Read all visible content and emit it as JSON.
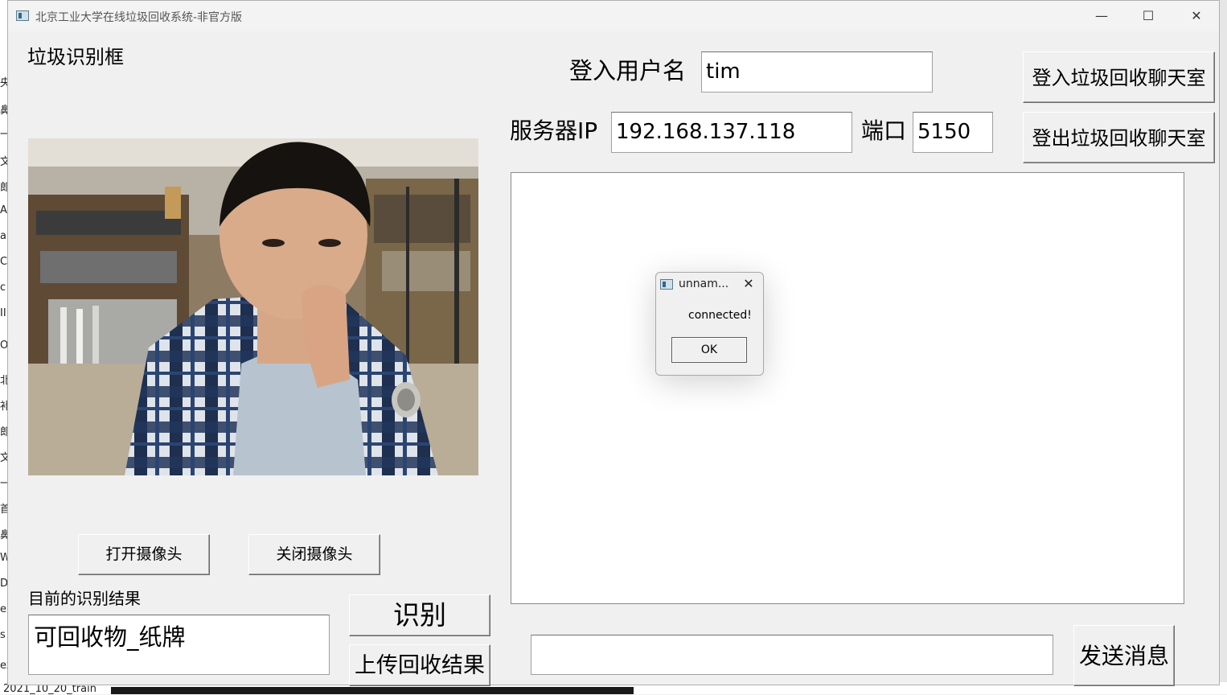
{
  "window": {
    "title": "北京工业大学在线垃圾回收系统-非官方版",
    "minimize_glyph": "—",
    "maximize_glyph": "☐",
    "close_glyph": "✕"
  },
  "left": {
    "frame_label": "垃圾识别框",
    "open_camera": "打开摄像头",
    "close_camera": "关闭摄像头",
    "result_label": "目前的识别结果",
    "result_value": "可回收物_纸牌",
    "recognize": "识别",
    "upload": "上传回收结果"
  },
  "right": {
    "username_label": "登入用户名",
    "username_value": "tim",
    "login_chat": "登入垃圾回收聊天室",
    "server_ip_label": "服务器IP",
    "server_ip_value": "192.168.137.118",
    "port_label": "端口",
    "port_value": "5150",
    "logout_chat": "登出垃圾回收聊天室",
    "message_value": "",
    "send": "发送消息"
  },
  "dialog": {
    "title": "unnam...",
    "message": "connected!",
    "ok": "OK",
    "close_glyph": "✕"
  },
  "background": {
    "bottom_text": "2021_10_20_train",
    "left_chars": [
      "央",
      "鼻",
      "一",
      "文",
      "郎",
      "A",
      "a",
      "C",
      "c",
      "II",
      "Or",
      "北",
      "补",
      "郎",
      "文",
      "一",
      "首",
      "鼻",
      "W",
      "D",
      "e",
      "s",
      "ex"
    ]
  },
  "colors": {
    "window_bg": "#f0f0f0",
    "field_bg": "#ffffff"
  }
}
